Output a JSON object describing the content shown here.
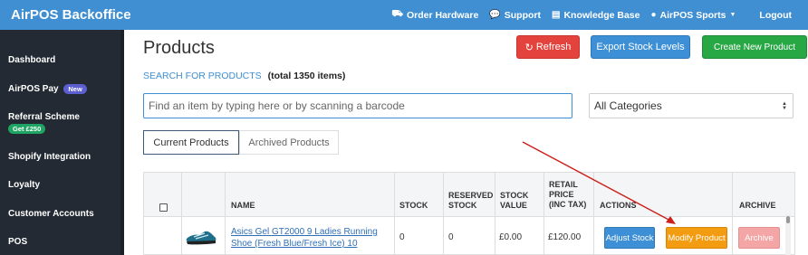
{
  "app": {
    "title": "AirPOS Backoffice"
  },
  "topnav": {
    "items": [
      {
        "label": "Order Hardware",
        "icon": "truck-icon"
      },
      {
        "label": "Support",
        "icon": "chat-icon"
      },
      {
        "label": "Knowledge Base",
        "icon": "book-icon"
      },
      {
        "label": "AirPOS Sports",
        "icon": "user-icon"
      }
    ],
    "logout": "Logout"
  },
  "sidebar": {
    "items": [
      {
        "label": "Dashboard"
      },
      {
        "label": "AirPOS Pay",
        "badge": "New"
      },
      {
        "label": "Referral Scheme",
        "badge": "Get £250"
      },
      {
        "label": "Shopify Integration"
      },
      {
        "label": "Loyalty"
      },
      {
        "label": "Customer Accounts"
      },
      {
        "label": "POS"
      }
    ]
  },
  "page": {
    "title": "Products",
    "refresh": "Refresh",
    "export": "Export Stock Levels",
    "create": "Create New Product",
    "search_link": "SEARCH FOR PRODUCTS",
    "total": "(total 1350 items)",
    "search_placeholder": "Find an item by typing here or by scanning a barcode",
    "category": "All Categories",
    "tabs": [
      "Current Products",
      "Archived Products"
    ]
  },
  "table": {
    "headers": {
      "name": "NAME",
      "stock": "STOCK",
      "reserved": [
        "RESERVED",
        "STOCK"
      ],
      "value": [
        "STOCK",
        "VALUE"
      ],
      "retail": [
        "RETAIL",
        "PRICE",
        "(INC TAX)"
      ],
      "actions": "ACTIONS",
      "archive": "ARCHIVE"
    },
    "rows": [
      {
        "name": "Asics Gel GT2000 9 Ladies Running Shoe (Fresh Blue/Fresh Ice) 10",
        "stock": "0",
        "reserved": "0",
        "value": "£0.00",
        "retail": "£120.00",
        "adjust": "Adjust Stock",
        "modify": "Modify Product",
        "archive": "Archive"
      }
    ]
  },
  "colors": {
    "topbar": "#3f8fd2",
    "sidebar": "#232a33",
    "refresh": "#e4423c",
    "export": "#3d8fd6",
    "create": "#28a745",
    "modify": "#f39c12",
    "archive": "#f4a6a6",
    "arrow": "#cc1f1a"
  }
}
